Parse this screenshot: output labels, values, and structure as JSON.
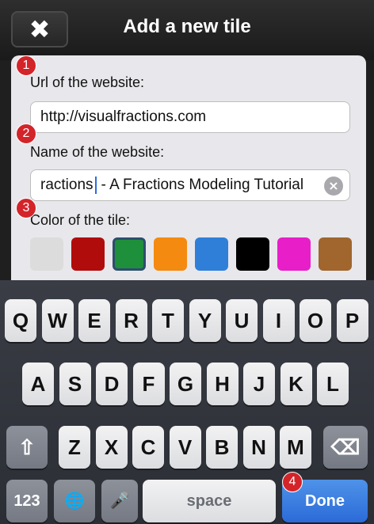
{
  "navbar": {
    "title": "Add a new tile",
    "close_glyph": "✖"
  },
  "form": {
    "url_label": "Url of the website:",
    "url_value": "http://visualfractions.com",
    "name_label": "Name of the website:",
    "name_before_cursor": "ractions",
    "name_after_cursor": "- A Fractions Modeling Tutorial",
    "clear_icon": "×",
    "color_label": "Color of the tile:",
    "colors": [
      "#dcdcdc",
      "#b10c0c",
      "#1e8f3a",
      "#f48a0f",
      "#2f7fd8",
      "#000000",
      "#e81ec9",
      "#a0662e"
    ],
    "selected_color": "#1e8f3a"
  },
  "badges": [
    "1",
    "2",
    "3",
    "4"
  ],
  "keyboard": {
    "row1": [
      "Q",
      "W",
      "E",
      "R",
      "T",
      "Y",
      "U",
      "I",
      "O",
      "P"
    ],
    "row2": [
      "A",
      "S",
      "D",
      "F",
      "G",
      "H",
      "J",
      "K",
      "L"
    ],
    "row3": [
      "Z",
      "X",
      "C",
      "V",
      "B",
      "N",
      "M"
    ],
    "shift_glyph": "⇧",
    "delete_glyph": "⌫",
    "numbers_label": "123",
    "globe_glyph": "🌐",
    "mic_glyph": "🎤",
    "space_label": "space",
    "done_label": "Done"
  }
}
